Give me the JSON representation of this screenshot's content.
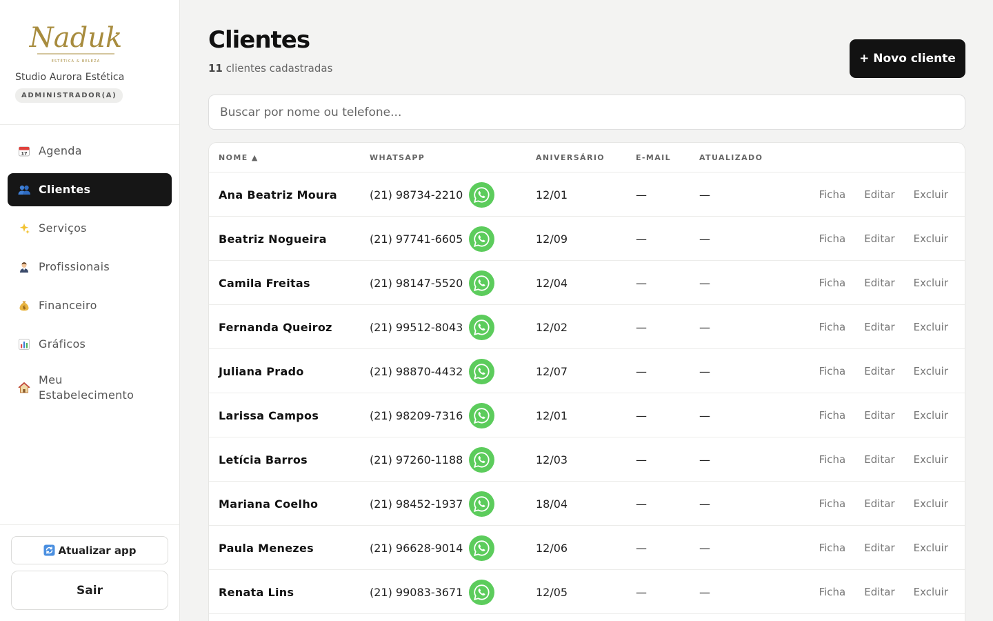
{
  "brand": {
    "logo_text": "Naduk",
    "logo_tagline": "ESTÉTICA & BELEZA",
    "studio_name": "Studio Aurora Estética",
    "role": "ADMINISTRADOR(A)"
  },
  "nav": [
    {
      "label": "Agenda",
      "icon": "calendar-icon"
    },
    {
      "label": "Clientes",
      "icon": "users-icon"
    },
    {
      "label": "Serviços",
      "icon": "sparkles-icon"
    },
    {
      "label": "Profissionais",
      "icon": "professional-icon"
    },
    {
      "label": "Financeiro",
      "icon": "money-bag-icon"
    },
    {
      "label": "Gráficos",
      "icon": "bar-chart-icon"
    },
    {
      "label": "Meu Estabelecimento",
      "icon": "house-icon"
    }
  ],
  "sidebar_footer": {
    "update_label": "Atualizar app",
    "logout_label": "Sair"
  },
  "page": {
    "title": "Clientes",
    "count": "11",
    "count_suffix": "clientes cadastradas",
    "new_button": "+ Novo cliente",
    "search_placeholder": "Buscar por nome ou telefone..."
  },
  "table": {
    "headers": {
      "name": "NOME ▲",
      "whatsapp": "WHATSAPP",
      "birthday": "ANIVERSÁRIO",
      "email": "E-MAIL",
      "updated": "ATUALIZADO"
    },
    "actions": {
      "ficha": "Ficha",
      "editar": "Editar",
      "excluir": "Excluir"
    },
    "rows": [
      {
        "name": "Ana Beatriz Moura",
        "phone": "(21) 98734-2210",
        "birthday": "12/01",
        "email": "—",
        "updated": "—"
      },
      {
        "name": "Beatriz Nogueira",
        "phone": "(21) 97741-6605",
        "birthday": "12/09",
        "email": "—",
        "updated": "—"
      },
      {
        "name": "Camila Freitas",
        "phone": "(21) 98147-5520",
        "birthday": "12/04",
        "email": "—",
        "updated": "—"
      },
      {
        "name": "Fernanda Queiroz",
        "phone": "(21) 99512-8043",
        "birthday": "12/02",
        "email": "—",
        "updated": "—"
      },
      {
        "name": "Juliana Prado",
        "phone": "(21) 98870-4432",
        "birthday": "12/07",
        "email": "—",
        "updated": "—"
      },
      {
        "name": "Larissa Campos",
        "phone": "(21) 98209-7316",
        "birthday": "12/01",
        "email": "—",
        "updated": "—"
      },
      {
        "name": "Letícia Barros",
        "phone": "(21) 97260-1188",
        "birthday": "12/03",
        "email": "—",
        "updated": "—"
      },
      {
        "name": "Mariana Coelho",
        "phone": "(21) 98452-1937",
        "birthday": "18/04",
        "email": "—",
        "updated": "—"
      },
      {
        "name": "Paula Menezes",
        "phone": "(21) 96628-9014",
        "birthday": "12/06",
        "email": "—",
        "updated": "—"
      },
      {
        "name": "Renata Lins",
        "phone": "(21) 99083-3671",
        "birthday": "12/05",
        "email": "—",
        "updated": "—"
      }
    ]
  },
  "colors": {
    "accent": "#161616",
    "whatsapp": "#5ccc5c",
    "logo_gold": "#a88c3e"
  }
}
